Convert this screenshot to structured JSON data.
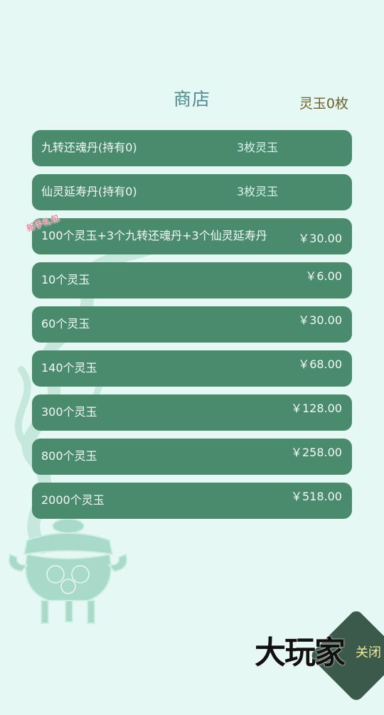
{
  "header": {
    "title": "商店",
    "currency": "灵玉0枚"
  },
  "shop": {
    "items": [
      {
        "name": "九转还魂丹(持有0)",
        "cost": "3枚灵玉"
      },
      {
        "name": "仙灵延寿丹(持有0)",
        "cost": "3枚灵玉"
      },
      {
        "name": "100个灵玉+3个九转还魂丹+3个仙灵延寿丹",
        "price": "￥30.00",
        "badge": "新手礼包"
      },
      {
        "name": "10个灵玉",
        "price": "￥6.00"
      },
      {
        "name": "60个灵玉",
        "price": "￥30.00"
      },
      {
        "name": "140个灵玉",
        "price": "￥68.00"
      },
      {
        "name": "300个灵玉",
        "price": "￥128.00"
      },
      {
        "name": "800个灵玉",
        "price": "￥258.00"
      },
      {
        "name": "2000个灵玉",
        "price": "￥518.00"
      }
    ]
  },
  "footer": {
    "close_label": "关闭",
    "watermark": "大玩家"
  },
  "colors": {
    "background": "#e6f8f3",
    "item_bg": "#4a8b6e",
    "title": "#4f8a92",
    "currency": "#6b6230",
    "badge": "#f05a78"
  }
}
